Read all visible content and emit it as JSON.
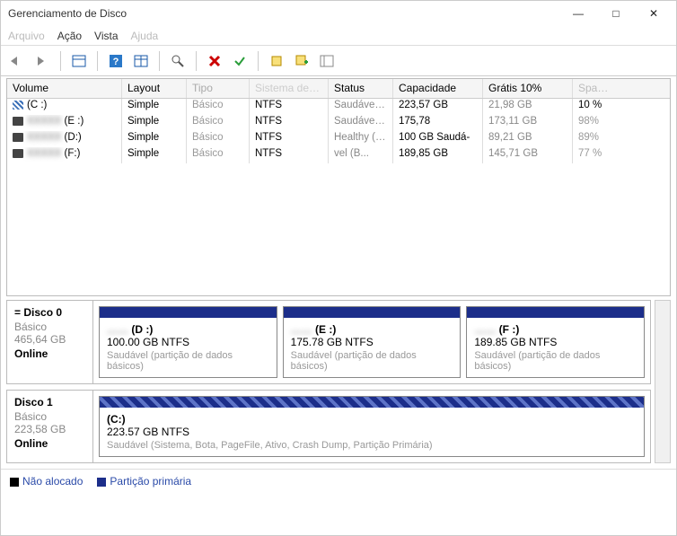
{
  "window": {
    "title": "Gerenciamento de Disco"
  },
  "menu": {
    "arquivo": "Arquivo",
    "acao": "Ação",
    "vista": "Vista",
    "ajuda": "Ajuda"
  },
  "headers": {
    "volume": "Volume",
    "layout": "Layout",
    "tipo": "Tipo",
    "fs": "Sistema de arquivo",
    "status": "Status",
    "capacidade": "Capacidade",
    "gratis": "Grátis 10%",
    "sp": "Spaço Grátis"
  },
  "volumes": [
    {
      "name": "(C :)",
      "layout": "Simple",
      "tipo": "Básico",
      "fs": "NTFS",
      "status": "Saudável (S...",
      "cap": "223,57 GB",
      "free": "21,98 GB",
      "pct": "10 %"
    },
    {
      "name": "(E :)",
      "layout": "Simple",
      "tipo": "Básico",
      "fs": "NTFS",
      "status": "Saudável (B...",
      "cap": "175,78",
      "free": "173,11 GB",
      "pct": "98%"
    },
    {
      "name": "(D:)",
      "layout": "Simple",
      "tipo": "Básico",
      "fs": "NTFS",
      "status": "Healthy (B...",
      "cap": "100 GB Saudá-",
      "free": "89,21 GB",
      "pct": "89%"
    },
    {
      "name": "(F:)",
      "layout": "Simple",
      "tipo": "Básico",
      "fs": "NTFS",
      "status": "vel (B...",
      "cap": "189,85 GB",
      "free": "145,71 GB",
      "pct": "77 %"
    }
  ],
  "disks": [
    {
      "name": "= Disco 0",
      "type": "Básico",
      "cap": "465,64 GB",
      "status": "Online",
      "parts": [
        {
          "label_blur": "……",
          "label_suffix": " (D :)",
          "size": "100.00 GB NTFS",
          "status": "Saudável (partição de dados básicos)"
        },
        {
          "label_blur": "……",
          "label_suffix": " (E :)",
          "size": "175.78 GB NTFS",
          "status": "Saudável (partição de dados básicos)"
        },
        {
          "label_blur": "……",
          "label_suffix": " (F :)",
          "size": "189.85 GB NTFS",
          "status": "Saudável (partição de dados básicos)"
        }
      ]
    },
    {
      "name": "Disco 1",
      "type": "Básico",
      "cap": "223,58 GB",
      "status": "Online",
      "parts": [
        {
          "label_blur": "",
          "label_suffix": "(C:)",
          "size": "223.57 GB NTFS",
          "status": "Saudável (Sistema, Bota, PageFile, Ativo, Crash Dump, Partição Primária)",
          "hatch": true
        }
      ]
    }
  ],
  "legend": {
    "unalloc": "Não alocado",
    "primary": "Partição primária"
  }
}
